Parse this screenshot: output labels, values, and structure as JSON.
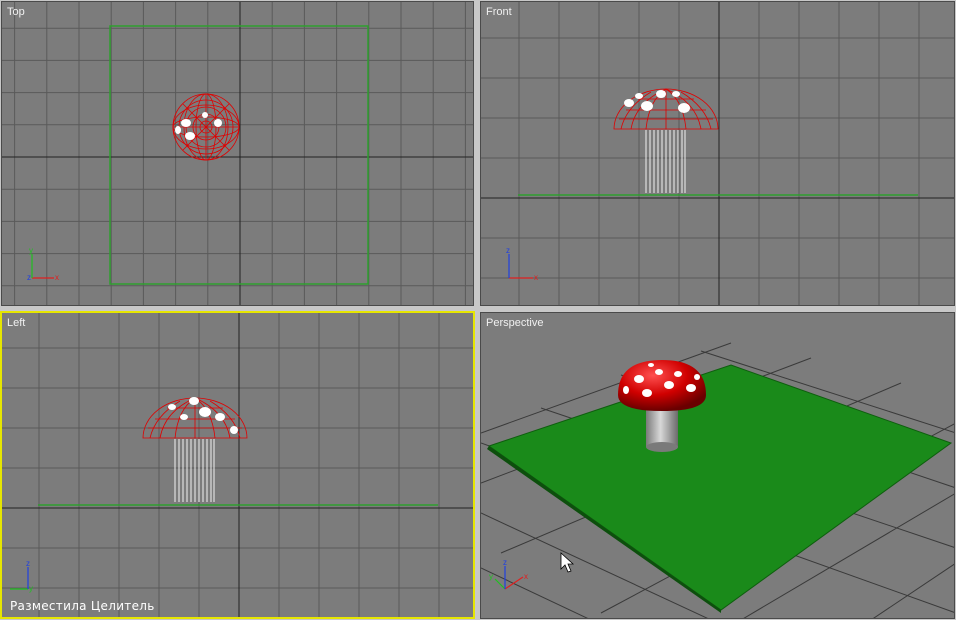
{
  "viewports": [
    {
      "id": "top",
      "label": "Top",
      "axis_h": "x",
      "axis_v": "y",
      "axis_corner": "z"
    },
    {
      "id": "front",
      "label": "Front",
      "axis_h": "x",
      "axis_v": "z",
      "axis_corner": "y"
    },
    {
      "id": "left",
      "label": "Left",
      "axis_h": "y",
      "axis_v": "z",
      "axis_corner": ""
    },
    {
      "id": "persp",
      "label": "Perspective",
      "axis_h": "x",
      "axis_v": "z",
      "axis_corner": "y"
    }
  ],
  "caption": "Разместила Целитель",
  "colors": {
    "viewport_bg": "#7c7c7c",
    "grid": "#5a5a5a",
    "grid_major": "#222222",
    "ground": "#1a8a1a",
    "ground_outline": "#2e9e2e",
    "mushroom_cap": "#e00000",
    "mushroom_stem": "#ffffff",
    "active_border": "#e6e600",
    "axis_x": "#e02020",
    "axis_y": "#20c020",
    "axis_z": "#2040e0"
  },
  "icons": {
    "cursor": "mouse-cursor-icon"
  }
}
